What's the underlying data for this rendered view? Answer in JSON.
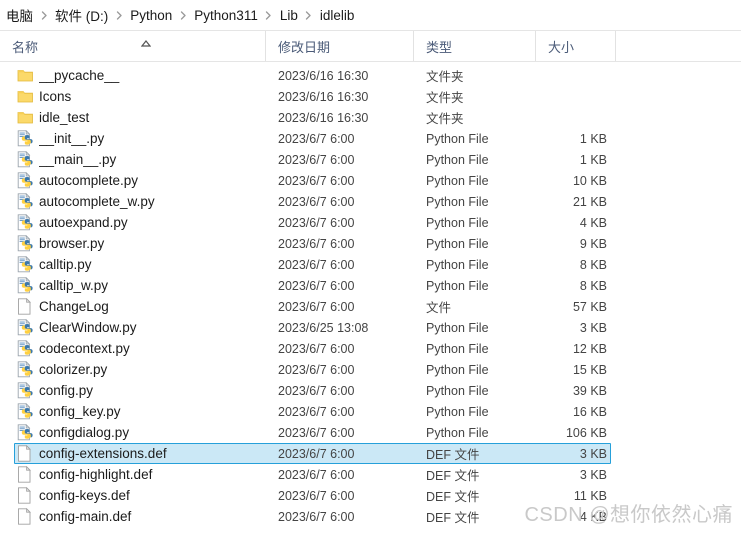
{
  "breadcrumb": {
    "items": [
      {
        "label": "电脑"
      },
      {
        "label": "软件 (D:)"
      },
      {
        "label": "Python"
      },
      {
        "label": "Python311"
      },
      {
        "label": "Lib"
      },
      {
        "label": "idlelib"
      }
    ],
    "separator_icon": "chevron-right-icon"
  },
  "columns": {
    "name": "名称",
    "date": "修改日期",
    "type": "类型",
    "size": "大小",
    "sort_icon": "sort-ascending-caret-icon"
  },
  "colors": {
    "selection_fill": "#cbe8f6",
    "selection_border": "#26a0da",
    "header_text": "#4b5b78",
    "folder_icon": "#fbd96a",
    "python_icon_blue": "#3c78aa",
    "python_icon_yellow": "#ffd040"
  },
  "files": [
    {
      "icon": "folder-icon",
      "name": "__pycache__",
      "date": "2023/6/16 16:30",
      "type": "文件夹",
      "size": "",
      "selected": false
    },
    {
      "icon": "folder-icon",
      "name": "Icons",
      "date": "2023/6/16 16:30",
      "type": "文件夹",
      "size": "",
      "selected": false
    },
    {
      "icon": "folder-icon",
      "name": "idle_test",
      "date": "2023/6/16 16:30",
      "type": "文件夹",
      "size": "",
      "selected": false
    },
    {
      "icon": "python-file-icon",
      "name": "__init__.py",
      "date": "2023/6/7 6:00",
      "type": "Python File",
      "size": "1 KB",
      "selected": false
    },
    {
      "icon": "python-file-icon",
      "name": "__main__.py",
      "date": "2023/6/7 6:00",
      "type": "Python File",
      "size": "1 KB",
      "selected": false
    },
    {
      "icon": "python-file-icon",
      "name": "autocomplete.py",
      "date": "2023/6/7 6:00",
      "type": "Python File",
      "size": "10 KB",
      "selected": false
    },
    {
      "icon": "python-file-icon",
      "name": "autocomplete_w.py",
      "date": "2023/6/7 6:00",
      "type": "Python File",
      "size": "21 KB",
      "selected": false
    },
    {
      "icon": "python-file-icon",
      "name": "autoexpand.py",
      "date": "2023/6/7 6:00",
      "type": "Python File",
      "size": "4 KB",
      "selected": false
    },
    {
      "icon": "python-file-icon",
      "name": "browser.py",
      "date": "2023/6/7 6:00",
      "type": "Python File",
      "size": "9 KB",
      "selected": false
    },
    {
      "icon": "python-file-icon",
      "name": "calltip.py",
      "date": "2023/6/7 6:00",
      "type": "Python File",
      "size": "8 KB",
      "selected": false
    },
    {
      "icon": "python-file-icon",
      "name": "calltip_w.py",
      "date": "2023/6/7 6:00",
      "type": "Python File",
      "size": "8 KB",
      "selected": false
    },
    {
      "icon": "plain-file-icon",
      "name": "ChangeLog",
      "date": "2023/6/7 6:00",
      "type": "文件",
      "size": "57 KB",
      "selected": false
    },
    {
      "icon": "python-file-icon",
      "name": "ClearWindow.py",
      "date": "2023/6/25 13:08",
      "type": "Python File",
      "size": "3 KB",
      "selected": false
    },
    {
      "icon": "python-file-icon",
      "name": "codecontext.py",
      "date": "2023/6/7 6:00",
      "type": "Python File",
      "size": "12 KB",
      "selected": false
    },
    {
      "icon": "python-file-icon",
      "name": "colorizer.py",
      "date": "2023/6/7 6:00",
      "type": "Python File",
      "size": "15 KB",
      "selected": false
    },
    {
      "icon": "python-file-icon",
      "name": "config.py",
      "date": "2023/6/7 6:00",
      "type": "Python File",
      "size": "39 KB",
      "selected": false
    },
    {
      "icon": "python-file-icon",
      "name": "config_key.py",
      "date": "2023/6/7 6:00",
      "type": "Python File",
      "size": "16 KB",
      "selected": false
    },
    {
      "icon": "python-file-icon",
      "name": "configdialog.py",
      "date": "2023/6/7 6:00",
      "type": "Python File",
      "size": "106 KB",
      "selected": false
    },
    {
      "icon": "plain-file-icon",
      "name": "config-extensions.def",
      "date": "2023/6/7 6:00",
      "type": "DEF 文件",
      "size": "3 KB",
      "selected": true
    },
    {
      "icon": "plain-file-icon",
      "name": "config-highlight.def",
      "date": "2023/6/7 6:00",
      "type": "DEF 文件",
      "size": "3 KB",
      "selected": false
    },
    {
      "icon": "plain-file-icon",
      "name": "config-keys.def",
      "date": "2023/6/7 6:00",
      "type": "DEF 文件",
      "size": "11 KB",
      "selected": false
    },
    {
      "icon": "plain-file-icon",
      "name": "config-main.def",
      "date": "2023/6/7 6:00",
      "type": "DEF 文件",
      "size": "4 KB",
      "selected": false
    }
  ],
  "watermark": {
    "text": "CSDN @想你依然心痛"
  }
}
